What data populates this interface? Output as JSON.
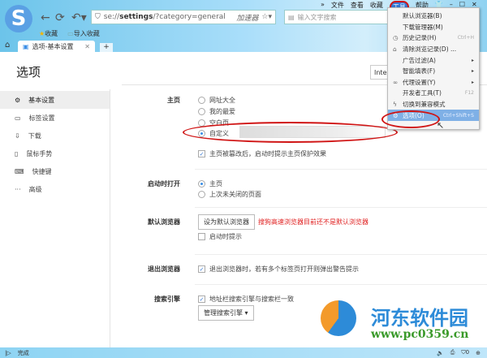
{
  "window": {
    "menus": [
      "»",
      "文件",
      "查看",
      "收藏",
      "工具",
      "帮助"
    ],
    "active_menu": "工具"
  },
  "toolbar": {
    "address": "se://settings/?category=general",
    "address_host": "se://",
    "address_bold": "settings",
    "address_rest": "/?category=general",
    "accelerator": "加速器",
    "search_placeholder": "输入文字搜索"
  },
  "bookmarks": [
    "收藏",
    "导入收藏"
  ],
  "tab": {
    "label": "选项-基本设置"
  },
  "page": {
    "title": "选项",
    "lang_select": "Inter"
  },
  "sidebar": {
    "items": [
      {
        "label": "基本设置",
        "icon": "gear-icon"
      },
      {
        "label": "标签设置",
        "icon": "tab-icon"
      },
      {
        "label": "下载",
        "icon": "download-icon"
      },
      {
        "label": "鼠标手势",
        "icon": "mouse-icon"
      },
      {
        "label": "快捷键",
        "icon": "keyboard-icon"
      },
      {
        "label": "高级",
        "icon": "more-icon"
      }
    ]
  },
  "homepage": {
    "label": "主页",
    "options": [
      "网址大全",
      "我的最爱",
      "空白页",
      "自定义"
    ],
    "selected": "自定义",
    "custom_value": "",
    "protect_check": "主页被篡改后，启动时提示主页保护效果",
    "protect_checked": true
  },
  "startup": {
    "label": "启动时打开",
    "options": [
      "主页",
      "上次未关闭的页面"
    ],
    "selected": "主页"
  },
  "default_browser": {
    "label": "默认浏览器",
    "button": "设为默认浏览器",
    "warning": "搜狗高速浏览器目前还不是默认浏览器",
    "check": "启动时提示",
    "checked": false
  },
  "exit": {
    "label": "退出浏览器",
    "check": "退出浏览器时，若有多个标签页打开则弹出警告提示",
    "checked": true
  },
  "search_engine": {
    "label": "搜索引擎",
    "check": "地址栏搜索引擎与搜索栏一致",
    "checked": true,
    "button": "管理搜索引擎"
  },
  "tools_menu": {
    "items": [
      {
        "label": "默认浏览器(B)",
        "shortcut": "",
        "icon": ""
      },
      {
        "label": "下载管理器(M)",
        "shortcut": "",
        "icon": ""
      },
      {
        "label": "历史记录(H)",
        "shortcut": "Ctrl+H",
        "icon": "clock-icon"
      },
      {
        "label": "清除浏览记录(D) ...",
        "shortcut": "",
        "icon": "eraser-icon"
      },
      {
        "label": "广告过滤(A)",
        "shortcut": "▸",
        "icon": ""
      },
      {
        "label": "智能填表(F)",
        "shortcut": "▸",
        "icon": ""
      },
      {
        "label": "代理设置(Y)",
        "shortcut": "▸",
        "icon": "link-icon"
      },
      {
        "label": "开发者工具(T)",
        "shortcut": "F12",
        "icon": ""
      },
      {
        "label": "切换到兼容模式",
        "shortcut": "",
        "icon": "lightning-icon"
      },
      {
        "label": "选项(O)",
        "shortcut": "Ctrl+Shift+S",
        "icon": "gear-icon"
      }
    ],
    "highlighted": "选项(O)"
  },
  "status": {
    "text": "完成",
    "shield_count": "0"
  },
  "watermark": {
    "name": "河东软件园",
    "url": "www.pc0359.cn"
  },
  "colors": {
    "accent": "#3a8ee6",
    "warning": "#e02020",
    "annotation": "#d01515"
  }
}
